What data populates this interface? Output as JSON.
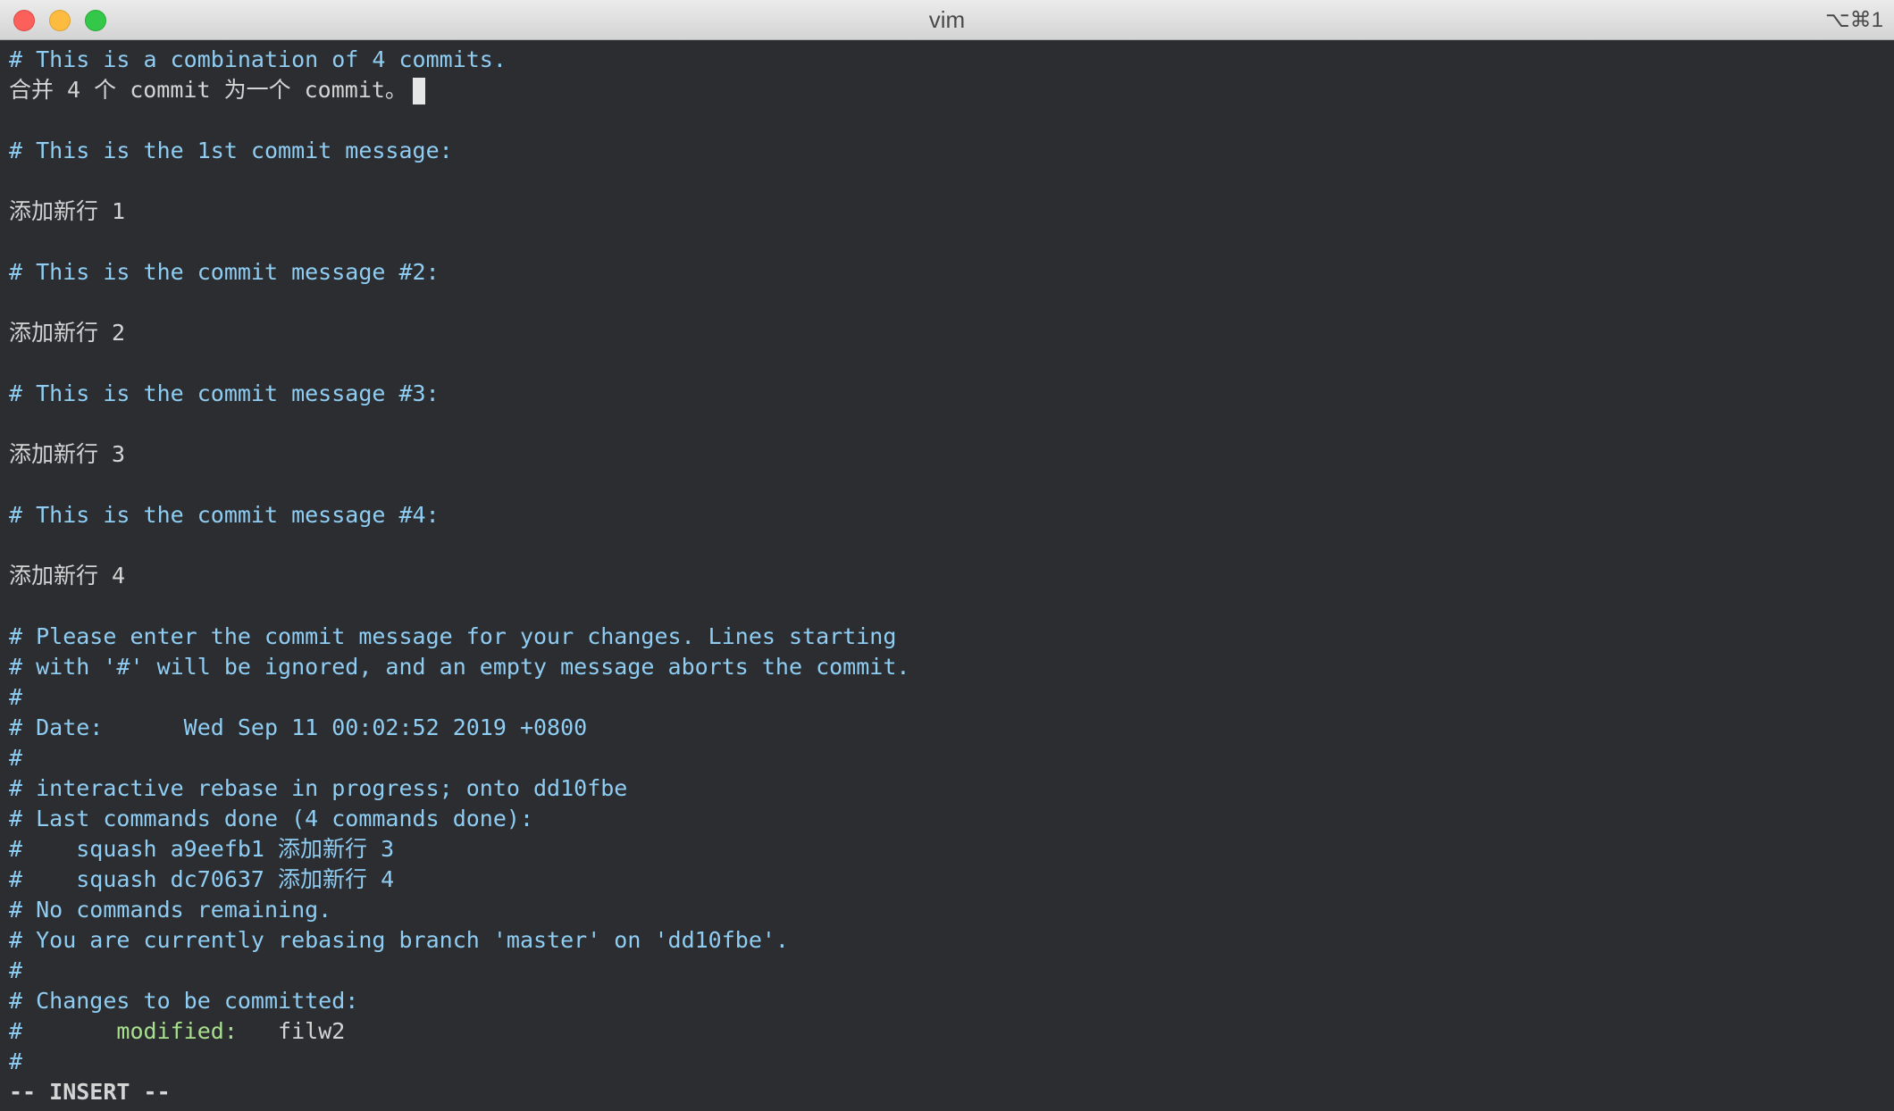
{
  "window": {
    "title": "vim",
    "shortcut": "⌥⌘1"
  },
  "editor": {
    "lines": [
      "# This is a combination of 4 commits.",
      "合并 4 个 commit 为一个 commit。",
      "",
      "# This is the 1st commit message:",
      "",
      "添加新行 1",
      "",
      "# This is the commit message #2:",
      "",
      "添加新行 2",
      "",
      "# This is the commit message #3:",
      "",
      "添加新行 3",
      "",
      "# This is the commit message #4:",
      "",
      "添加新行 4",
      "",
      "# Please enter the commit message for your changes. Lines starting",
      "# with '#' will be ignored, and an empty message aborts the commit.",
      "#",
      "# Date:      Wed Sep 11 00:02:52 2019 +0800",
      "#",
      "# interactive rebase in progress; onto dd10fbe",
      "# Last commands done (4 commands done):",
      "#    squash a9eefb1 添加新行 3",
      "#    squash dc70637 添加新行 4",
      "# No commands remaining.",
      "# You are currently rebasing branch 'master' on 'dd10fbe'.",
      "#",
      "# Changes to be committed:",
      {
        "prefix": "#       ",
        "status": "modified:",
        "file": "   filw2"
      },
      "#"
    ],
    "mode": "-- INSERT --"
  },
  "colors": {
    "background": "#2b2d31",
    "comment": "#8fcdf3",
    "text": "#d4d4d4",
    "modified": "#a8e08e"
  }
}
